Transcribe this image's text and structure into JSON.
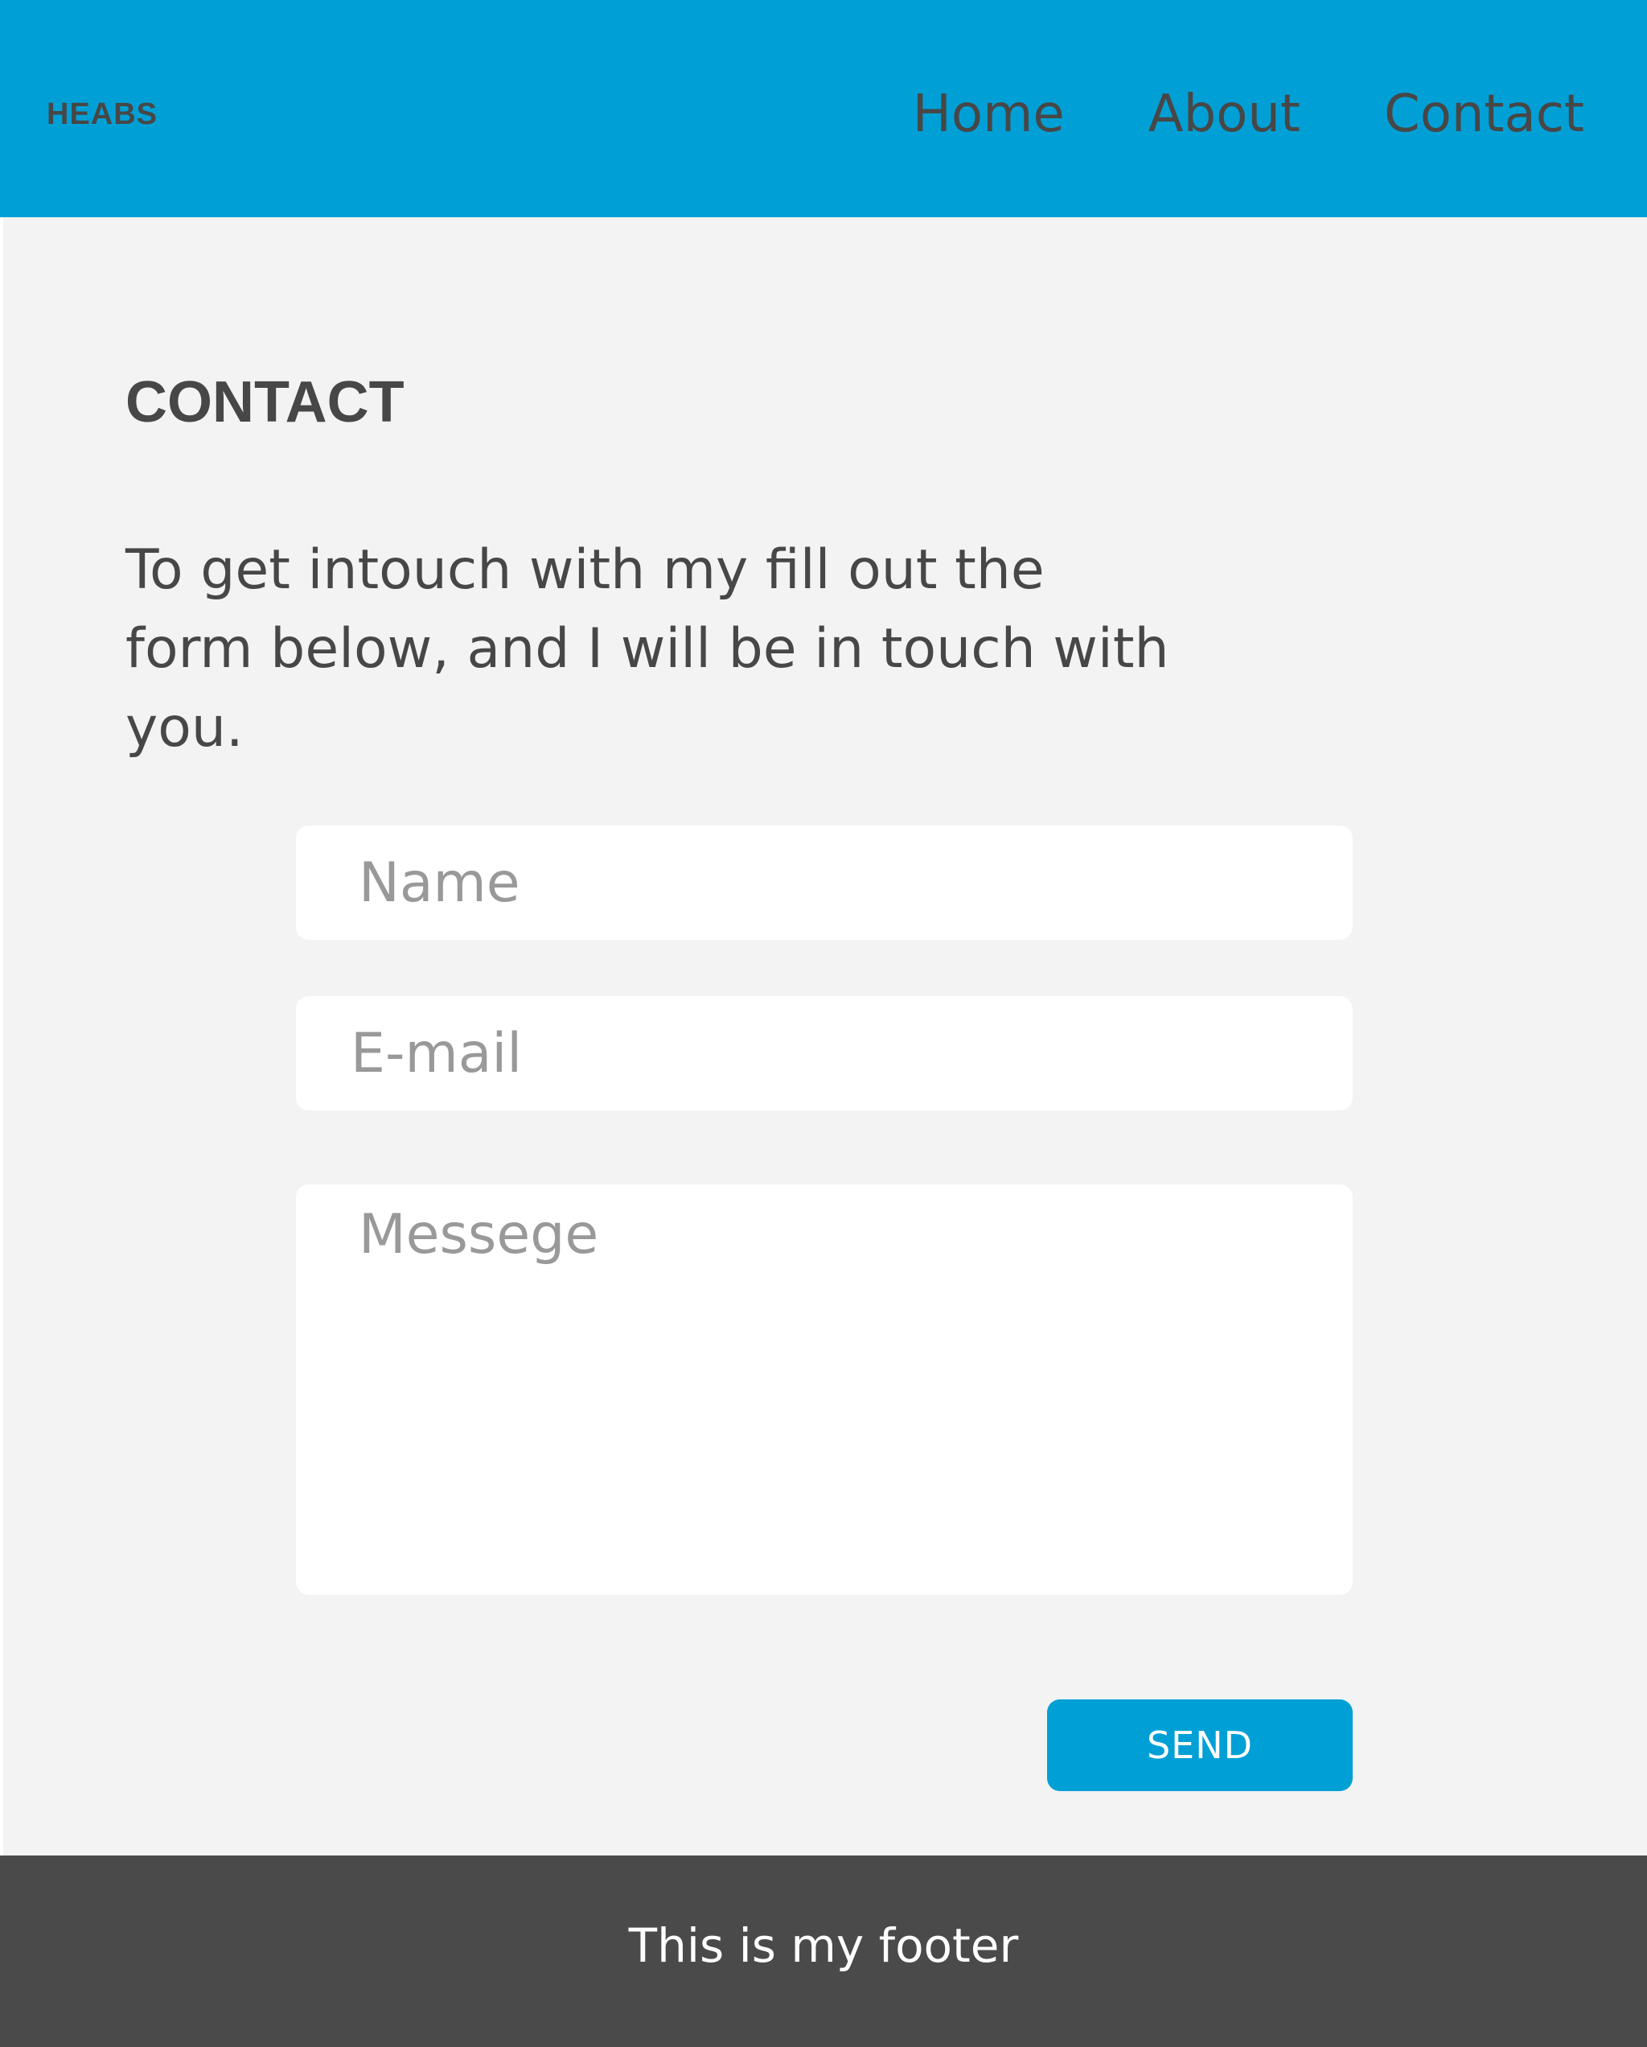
{
  "brand": {
    "logo_text": "HEABS"
  },
  "nav": {
    "items": [
      {
        "label": "Home"
      },
      {
        "label": "About"
      },
      {
        "label": "Contact"
      }
    ]
  },
  "main": {
    "title": "CONTACT",
    "intro": "To get intouch with my fill out the form below, and I will be in touch with you.",
    "form": {
      "name_placeholder": "Name",
      "email_placeholder": "E-mail",
      "message_placeholder": "Messege",
      "send_label": "SEND"
    }
  },
  "footer": {
    "text": "This is my footer"
  },
  "colors": {
    "accent": "#00a0d6",
    "background": "#f3f3f3",
    "text": "#474747",
    "footer_bg": "#4a4a4a"
  }
}
